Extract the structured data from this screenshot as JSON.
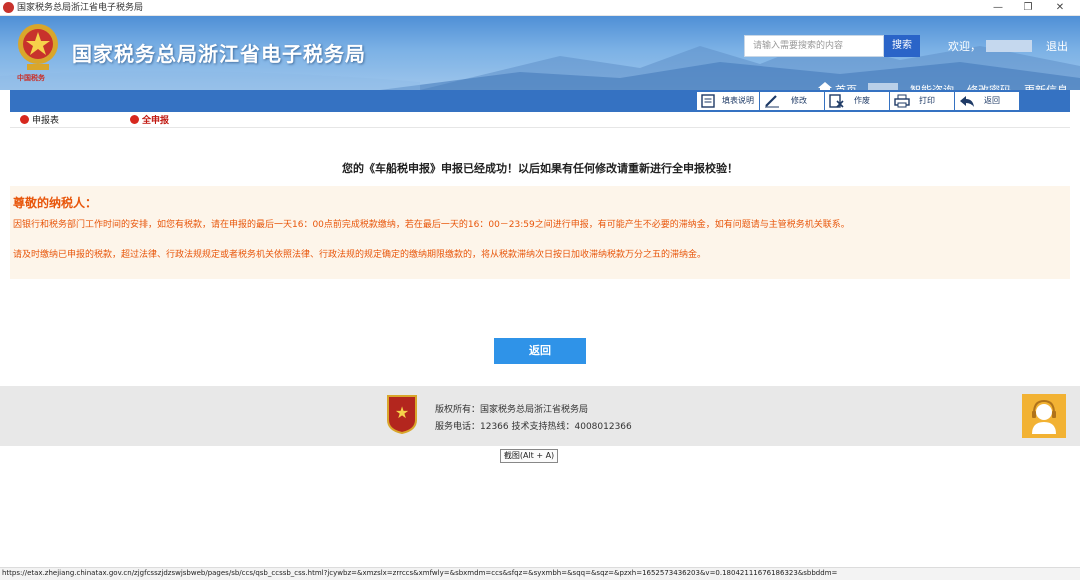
{
  "window": {
    "title": "国家税务总局浙江省电子税务局"
  },
  "header": {
    "emblem_text": "中国税务",
    "site_title": "国家税务总局浙江省电子税务局",
    "search": {
      "placeholder": "请输入需要搜索的内容",
      "button": "搜索"
    },
    "welcome": "欢迎，",
    "logout": "退出",
    "nav": {
      "home": "首页",
      "links": [
        "智能咨询",
        "修改密码",
        "更新信息"
      ]
    }
  },
  "toolbar": {
    "items": [
      {
        "label": "填表说明",
        "icon": "instructions-icon"
      },
      {
        "label": "修改",
        "icon": "edit-icon"
      },
      {
        "label": "作废",
        "icon": "void-icon"
      },
      {
        "label": "打印",
        "icon": "print-icon"
      },
      {
        "label": "返回",
        "icon": "back-arrow-icon"
      }
    ]
  },
  "tabs": [
    {
      "label": "申报表",
      "active": false
    },
    {
      "label": "全申报",
      "active": true
    }
  ],
  "message": {
    "success": "您的《车船税申报》申报已经成功！以后如果有任何修改请重新进行全申报校验！"
  },
  "notice": {
    "title": "尊敬的纳税人：",
    "paragraphs": [
      "因银行和税务部门工作时间的安排，如您有税款，请在申报的最后一天16：00点前完成税款缴纳，若在最后一天的16：00－23:59之间进行申报，有可能产生不必要的滞纳金，如有问题请与主管税务机关联系。",
      "请及时缴纳已申报的税款，超过法律、行政法规规定或者税务机关依照法律、行政法规的规定确定的缴纳期限缴款的，将从税款滞纳次日按日加收滞纳税款万分之五的滞纳金。"
    ]
  },
  "return_button": "返回",
  "footer": {
    "copyright": "版权所有：国家税务总局浙江省税务局",
    "contact": "服务电话：12366 技术支持热线：4008012366"
  },
  "tooltip": "截图(Alt + A)",
  "statusbar": {
    "url": "https://etax.zhejiang.chinatax.gov.cn/zjgfcsszjdzswjsbweb/pages/sb/ccs/qsb_ccssb_css.html?jcywbz=&xmzslx=zrrccs&xmfwly=&sbxmdm=ccs&sfqz=&syxmbh=&sqq=&sqz=&pzxh=1652573436203&v=0.18042111676186323&sbbddm="
  },
  "colors": {
    "toolbar_blue": "#3572c2",
    "accent_orange": "#e8560b",
    "tab_red": "#d7281e",
    "button_blue": "#2f93e8"
  }
}
